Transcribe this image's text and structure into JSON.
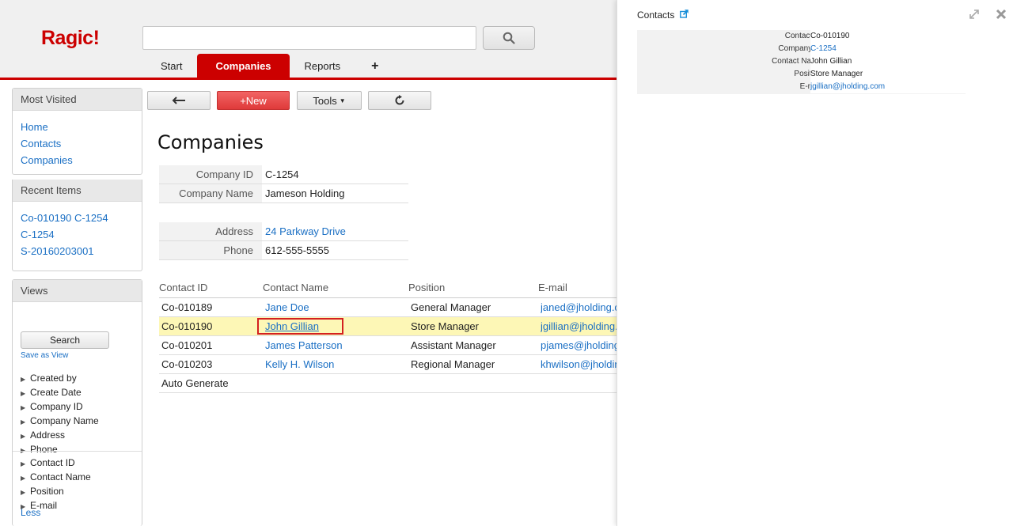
{
  "app": {
    "logo": "Ragic!"
  },
  "search": {
    "placeholder": ""
  },
  "nav": {
    "tabs": [
      {
        "label": "Start"
      },
      {
        "label": "Companies"
      },
      {
        "label": "Reports"
      },
      {
        "label": "+"
      }
    ]
  },
  "sidebar": {
    "most_visited": {
      "title": "Most Visited",
      "links": [
        "Home",
        "Contacts",
        "Companies"
      ]
    },
    "recent_items": {
      "title": "Recent Items",
      "links": [
        "Co-010190 C-1254",
        "C-1254",
        "S-20160203001"
      ]
    },
    "views": {
      "title": "Views",
      "search_label": "Search",
      "save_label": "Save as View",
      "fields_group1": [
        "Created by",
        "Create Date",
        "Company ID",
        "Company Name",
        "Address",
        "Phone"
      ],
      "fields_group2": [
        "Contact ID",
        "Contact Name",
        "Position",
        "E-mail"
      ],
      "less_label": "Less"
    }
  },
  "toolbar": {
    "new_label": "+New",
    "tools_label": "Tools"
  },
  "form": {
    "title": "Companies",
    "company_id_label": "Company ID",
    "company_id": "C-1254",
    "company_name_label": "Company Name",
    "company_name": "Jameson Holding",
    "address_label": "Address",
    "address": "24 Parkway Drive",
    "phone_label": "Phone",
    "phone": "612-555-5555"
  },
  "contacts": {
    "headers": [
      "Contact ID",
      "Contact Name",
      "Position",
      "E-mail"
    ],
    "rows": [
      {
        "id": "Co-010189",
        "name": "Jane Doe",
        "position": "General Manager",
        "email": "janed@jholding.com"
      },
      {
        "id": "Co-010190",
        "name": "John Gillian",
        "position": "Store Manager",
        "email": "jgillian@jholding.com"
      },
      {
        "id": "Co-010201",
        "name": "James Patterson",
        "position": "Assistant Manager",
        "email": "pjames@jholding.com"
      },
      {
        "id": "Co-010203",
        "name": "Kelly H. Wilson",
        "position": "Regional Manager",
        "email": "khwilson@jholding.com"
      }
    ],
    "auto_generate": "Auto Generate"
  },
  "popup": {
    "title": "Contacts",
    "fields": [
      {
        "label": "Contact ID",
        "value": "Co-010190"
      },
      {
        "label": "Company ID",
        "value": "C-1254"
      },
      {
        "label": "Contact Name",
        "value": "John Gillian"
      },
      {
        "label": "Position",
        "value": "Store Manager"
      },
      {
        "label": "E-mail",
        "value": "jgillian@jholding.com"
      }
    ]
  },
  "colors": {
    "brand": "#cc0000",
    "link": "#1a6fc4",
    "highlight_row": "#fdf7b6"
  }
}
